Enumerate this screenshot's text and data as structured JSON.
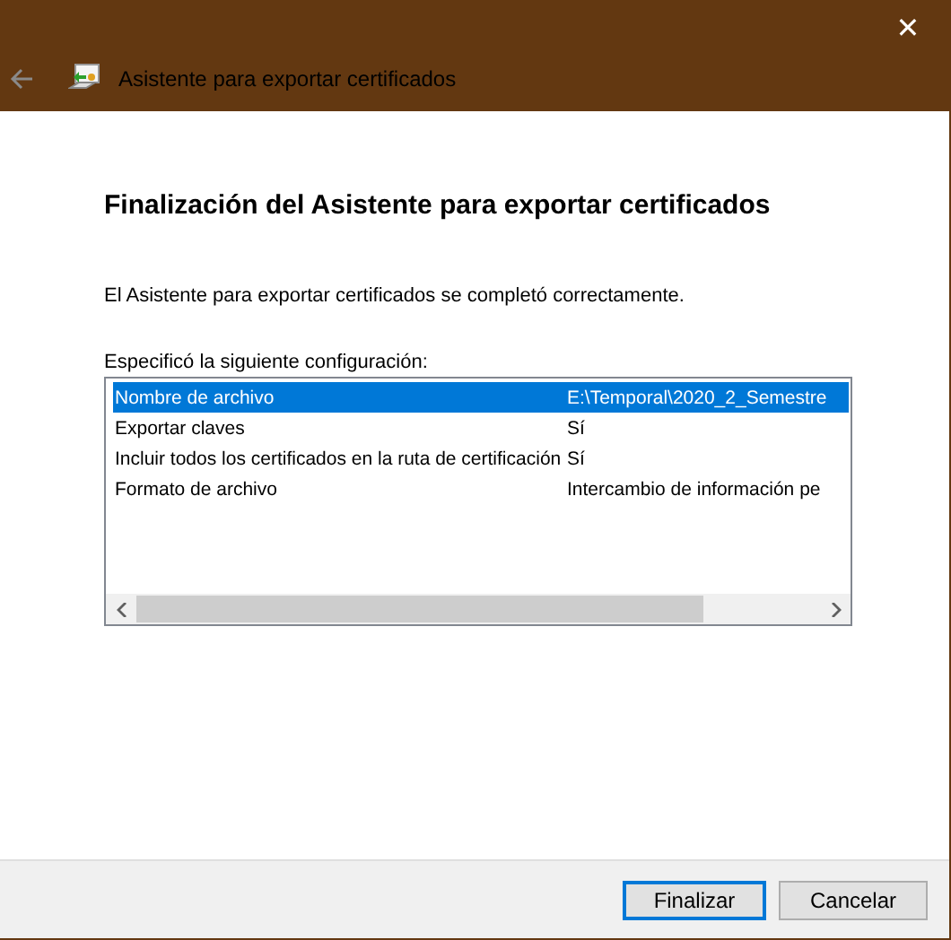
{
  "window": {
    "title": "Asistente para exportar certificados",
    "close": "✕"
  },
  "heading": "Finalización del Asistente para exportar certificados",
  "message": "El Asistente para exportar certificados se completó correctamente.",
  "list_label": "Especificó la siguiente configuración:",
  "settings": [
    {
      "name": "Nombre de archivo",
      "value": "E:\\Temporal\\2020_2_Semestre",
      "selected": true
    },
    {
      "name": "Exportar claves",
      "value": "Sí",
      "selected": false
    },
    {
      "name": "Incluir todos los certificados en la ruta de certificación",
      "value": "Sí",
      "selected": false
    },
    {
      "name": "Formato de archivo",
      "value": "Intercambio de información pe",
      "selected": false
    }
  ],
  "buttons": [
    {
      "label": "Finalizar",
      "kind": "default"
    },
    {
      "label": "Cancelar",
      "kind": "normal"
    }
  ]
}
